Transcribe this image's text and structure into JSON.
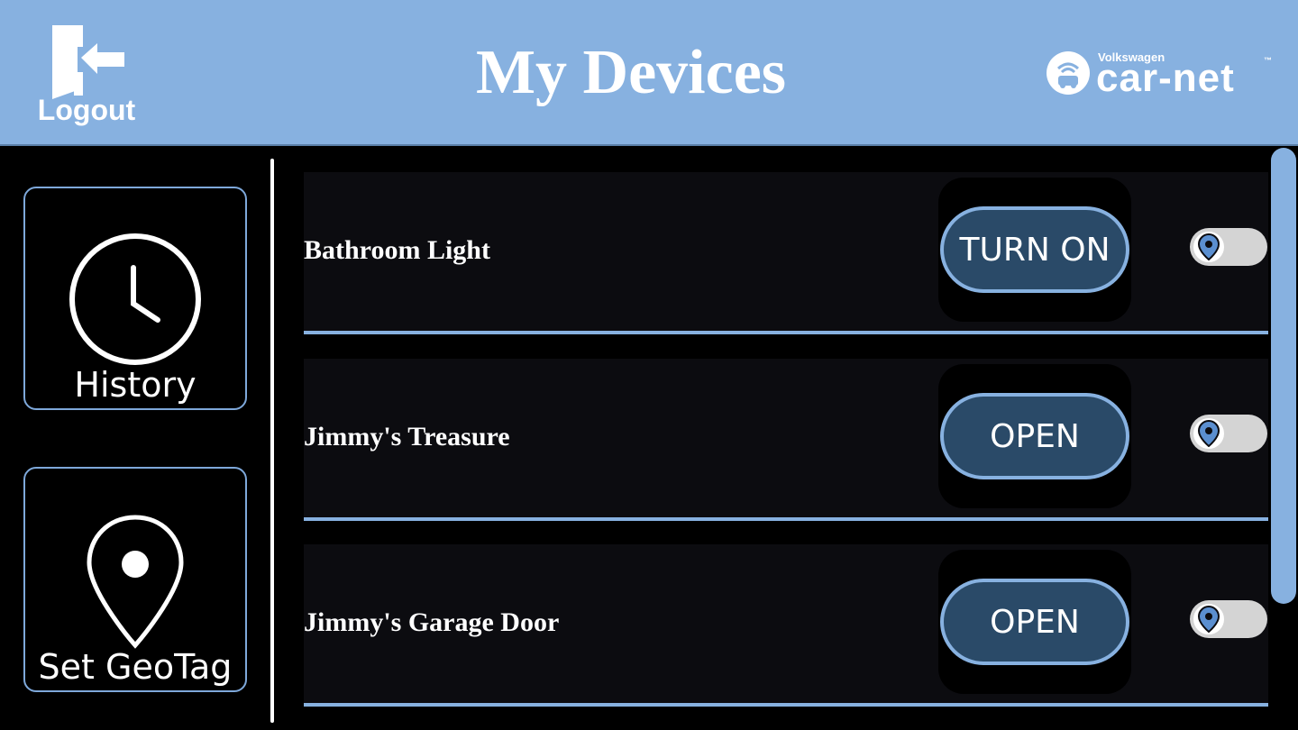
{
  "header": {
    "logout_label": "Logout",
    "title": "My Devices",
    "brand": {
      "small": "Volkswagen",
      "main": "car-net",
      "tm": "™"
    }
  },
  "sidebar": {
    "history_label": "History",
    "geotag_label": "Set GeoTag"
  },
  "devices": [
    {
      "name": "Bathroom Light",
      "action": "TURN ON"
    },
    {
      "name": "Jimmy's Treasure",
      "action": "OPEN"
    },
    {
      "name": "Jimmy's Garage Door",
      "action": "OPEN"
    }
  ],
  "colors": {
    "header_bg": "#87b1e0",
    "accent": "#87b1e0",
    "button_fill": "#2a4a68",
    "background": "#000000"
  },
  "icons": [
    "logout-icon",
    "clock-icon",
    "map-pin-icon",
    "car-net-logo-icon"
  ]
}
